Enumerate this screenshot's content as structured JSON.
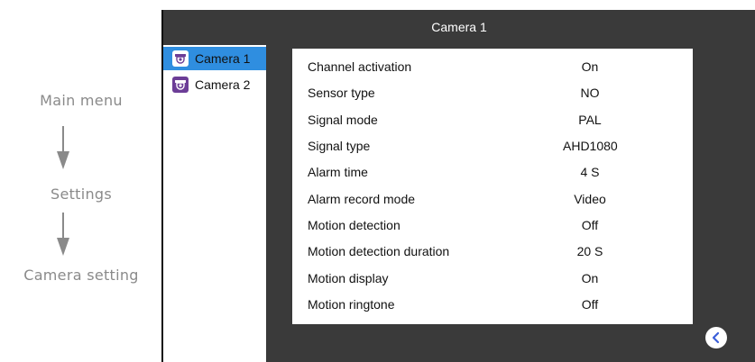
{
  "nav": {
    "steps": [
      "Main menu",
      "Settings",
      "Camera setting"
    ]
  },
  "screen": {
    "title": "Camera 1",
    "cameras": [
      {
        "label": "Camera 1",
        "active": true
      },
      {
        "label": "Camera 2",
        "active": false
      }
    ],
    "settings": [
      {
        "label": "Channel activation",
        "value": "On"
      },
      {
        "label": "Sensor type",
        "value": "NO"
      },
      {
        "label": "Signal mode",
        "value": "PAL"
      },
      {
        "label": "Signal type",
        "value": "AHD1080"
      },
      {
        "label": "Alarm time",
        "value": "4 S"
      },
      {
        "label": "Alarm record mode",
        "value": "Video"
      },
      {
        "label": "Motion detection",
        "value": "Off"
      },
      {
        "label": "Motion detection duration",
        "value": "20 S"
      },
      {
        "label": "Motion display",
        "value": "On"
      },
      {
        "label": "Motion ringtone",
        "value": "Off"
      }
    ]
  },
  "icons": {
    "camera": "security-camera-icon",
    "back": "back-arrow-icon",
    "nav_arrow": "down-arrow-icon"
  },
  "colors": {
    "selected": "#2f8ee0",
    "camera2_icon": "#6c3d97",
    "panel_bg": "#3a3a3a",
    "back_icon": "#3b5fd9"
  }
}
